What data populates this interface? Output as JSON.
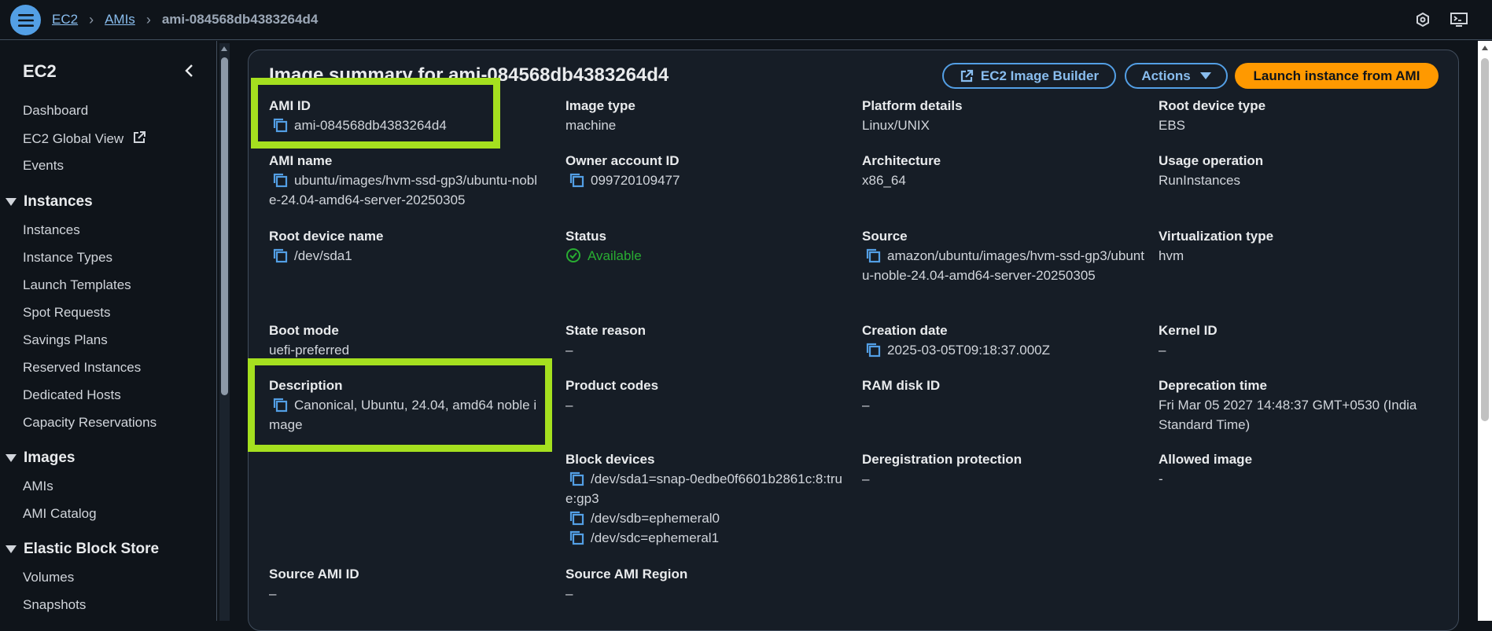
{
  "topbar": {
    "breadcrumb": [
      "EC2",
      "AMIs",
      "ami-084568db4383264d4"
    ],
    "icons": [
      "menu-icon",
      "notifications-icon",
      "cloudshell-icon"
    ]
  },
  "sidebar": {
    "title": "EC2",
    "items_top": [
      "Dashboard",
      "EC2 Global View",
      "Events"
    ],
    "sections": [
      {
        "label": "Instances",
        "items": [
          "Instances",
          "Instance Types",
          "Launch Templates",
          "Spot Requests",
          "Savings Plans",
          "Reserved Instances",
          "Dedicated Hosts",
          "Capacity Reservations"
        ]
      },
      {
        "label": "Images",
        "items": [
          "AMIs",
          "AMI Catalog"
        ]
      },
      {
        "label": "Elastic Block Store",
        "items": [
          "Volumes",
          "Snapshots"
        ]
      }
    ]
  },
  "panel": {
    "title": "Image summary for ami-084568db4383264d4",
    "buttons": {
      "image_builder": "EC2 Image Builder",
      "actions": "Actions",
      "launch": "Launch instance from AMI"
    },
    "fields": {
      "ami_id": {
        "label": "AMI ID",
        "value": "ami-084568db4383264d4"
      },
      "image_type": {
        "label": "Image type",
        "value": "machine"
      },
      "platform_details": {
        "label": "Platform details",
        "value": "Linux/UNIX"
      },
      "root_device_type": {
        "label": "Root device type",
        "value": "EBS"
      },
      "ami_name": {
        "label": "AMI name",
        "value": "ubuntu/images/hvm-ssd-gp3/ubuntu-noble-24.04-amd64-server-20250305"
      },
      "owner_account_id": {
        "label": "Owner account ID",
        "value": "099720109477"
      },
      "architecture": {
        "label": "Architecture",
        "value": "x86_64"
      },
      "usage_operation": {
        "label": "Usage operation",
        "value": "RunInstances"
      },
      "root_device_name": {
        "label": "Root device name",
        "value": "/dev/sda1"
      },
      "status": {
        "label": "Status",
        "value": "Available"
      },
      "source": {
        "label": "Source",
        "value": "amazon/ubuntu/images/hvm-ssd-gp3/ubuntu-noble-24.04-amd64-server-20250305"
      },
      "virtualization_type": {
        "label": "Virtualization type",
        "value": "hvm"
      },
      "boot_mode": {
        "label": "Boot mode",
        "value": "uefi-preferred"
      },
      "state_reason": {
        "label": "State reason",
        "value": "–"
      },
      "creation_date": {
        "label": "Creation date",
        "value": "2025-03-05T09:18:37.000Z"
      },
      "kernel_id": {
        "label": "Kernel ID",
        "value": "–"
      },
      "description": {
        "label": "Description",
        "value": "Canonical, Ubuntu, 24.04, amd64 noble image"
      },
      "product_codes": {
        "label": "Product codes",
        "value": "–"
      },
      "ram_disk_id": {
        "label": "RAM disk ID",
        "value": "–"
      },
      "deprecation_time": {
        "label": "Deprecation time",
        "value": "Fri Mar 05 2027 14:48:37 GMT+0530 (India Standard Time)"
      },
      "block_devices": {
        "label": "Block devices",
        "values": [
          "/dev/sda1=snap-0edbe0f6601b2861c:8:true:gp3",
          "/dev/sdb=ephemeral0",
          "/dev/sdc=ephemeral1"
        ]
      },
      "deregistration_protection": {
        "label": "Deregistration protection",
        "value": "–"
      },
      "allowed_image": {
        "label": "Allowed image",
        "value": "-"
      },
      "source_ami_id": {
        "label": "Source AMI ID",
        "value": "–"
      },
      "source_ami_region": {
        "label": "Source AMI Region",
        "value": "–"
      }
    }
  },
  "colors": {
    "accent": "#539fe5",
    "primary_button": "#ff9900",
    "status_available": "#29ad32",
    "highlight": "#a5e01f"
  }
}
